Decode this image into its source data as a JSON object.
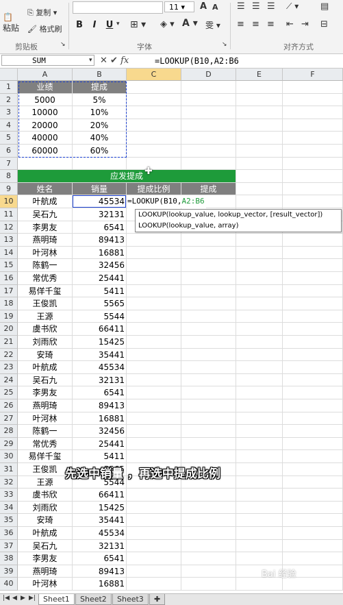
{
  "ribbon": {
    "paste": "粘贴",
    "copy": "复制",
    "format_painter": "格式刷",
    "clipboard_group": "剪贴板",
    "font_group": "字体",
    "align_group": "对齐方式",
    "font_size": "11",
    "bold": "B",
    "italic": "I",
    "underline": "U"
  },
  "formula_bar": {
    "name_box": "SUM",
    "formula": "=LOOKUP(B10,A2:B6"
  },
  "columns": [
    "A",
    "B",
    "C",
    "D",
    "E",
    "F"
  ],
  "rows": [
    "1",
    "2",
    "3",
    "4",
    "5",
    "6",
    "7",
    "8",
    "9",
    "10",
    "11",
    "12",
    "13",
    "14",
    "15",
    "16",
    "17",
    "18",
    "19",
    "20",
    "21",
    "22",
    "23",
    "24",
    "25",
    "26",
    "27",
    "28",
    "29",
    "30",
    "31",
    "32",
    "33",
    "34",
    "35",
    "36",
    "37",
    "38",
    "39",
    "40"
  ],
  "lookup_table": {
    "headers": [
      "业绩",
      "提成"
    ],
    "rows": [
      [
        "5000",
        "5%"
      ],
      [
        "10000",
        "10%"
      ],
      [
        "20000",
        "20%"
      ],
      [
        "40000",
        "40%"
      ],
      [
        "60000",
        "60%"
      ]
    ]
  },
  "main_table": {
    "title": "应发提成",
    "headers": [
      "姓名",
      "销量",
      "提成比例",
      "提成"
    ],
    "edit_cell": "=LOOKUP(B10,",
    "edit_ref": "A2:B6",
    "rows": [
      [
        "叶航成",
        "45534"
      ],
      [
        "吴石九",
        "32131"
      ],
      [
        "李男友",
        "6541"
      ],
      [
        "燕明琦",
        "89413"
      ],
      [
        "叶河林",
        "16881"
      ],
      [
        "陈鹤一",
        "32456"
      ],
      [
        "常优秀",
        "25441"
      ],
      [
        "易佯千玺",
        "5411"
      ],
      [
        "王俊凯",
        "5565"
      ],
      [
        "王源",
        "5544"
      ],
      [
        "虞书欣",
        "66411"
      ],
      [
        "刘雨欣",
        "15425"
      ],
      [
        "安琦",
        "35441"
      ],
      [
        "叶航成",
        "45534"
      ],
      [
        "吴石九",
        "32131"
      ],
      [
        "李男友",
        "6541"
      ],
      [
        "燕明琦",
        "89413"
      ],
      [
        "叶河林",
        "16881"
      ],
      [
        "陈鹤一",
        "32456"
      ],
      [
        "常优秀",
        "25441"
      ],
      [
        "易佯千玺",
        "5411"
      ],
      [
        "王俊凯",
        "5565"
      ],
      [
        "王源",
        "5544"
      ],
      [
        "虞书欣",
        "66411"
      ],
      [
        "刘雨欣",
        "15425"
      ],
      [
        "安琦",
        "35441"
      ],
      [
        "叶航成",
        "45534"
      ],
      [
        "吴石九",
        "32131"
      ],
      [
        "李男友",
        "6541"
      ],
      [
        "燕明琦",
        "89413"
      ],
      [
        "叶河林",
        "16881"
      ]
    ]
  },
  "tooltip": {
    "line1": "LOOKUP(lookup_value, lookup_vector, [result_vector])",
    "line2": "LOOKUP(lookup_value, array)"
  },
  "sheet_tabs": [
    "Sheet1",
    "Sheet2",
    "Sheet3"
  ],
  "caption": "先选中销量 ，再选中提成比例",
  "watermark": "Bai 经验",
  "colors": {
    "green": "#1e9b3a",
    "gray": "#808080",
    "selection": "#f8d98e",
    "ref_green": "#1e9b3a",
    "ref_blue": "#1a3fd1"
  }
}
